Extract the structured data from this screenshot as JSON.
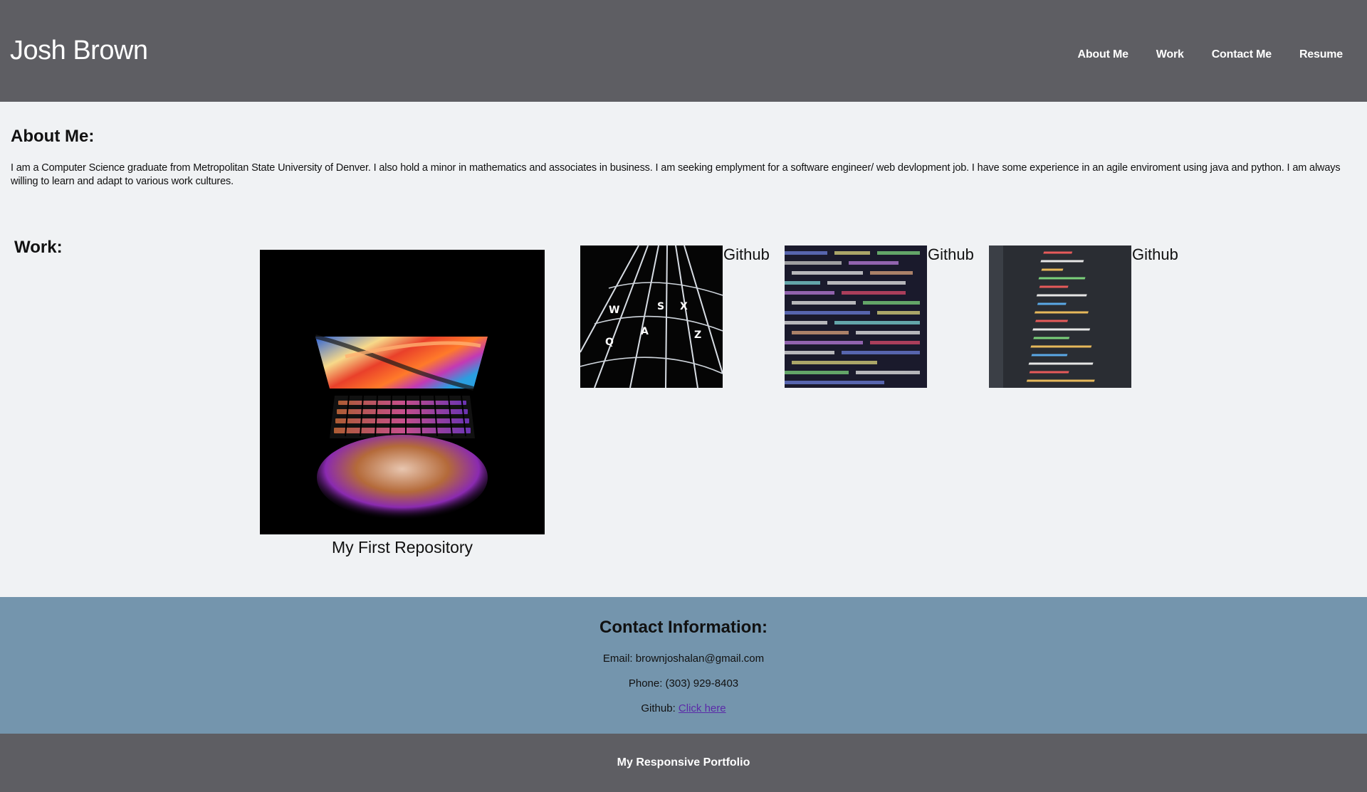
{
  "header": {
    "title": "Josh Brown",
    "nav": [
      "About Me",
      "Work",
      "Contact Me",
      "Resume"
    ]
  },
  "about": {
    "heading": "About Me:",
    "text": "I am a Computer Science graduate from Metropolitan State University of Denver. I also hold a minor in mathematics and associates in business. I am seeking emplyment for a software engineer/ web devlopment job. I have some experience in an agile enviroment using java and python. I am always willing to learn and adapt to various work cultures."
  },
  "work": {
    "heading": "Work:",
    "main_caption": "My First Repository",
    "thumb_label_1": "Github",
    "thumb_label_2": "Github",
    "thumb_label_3": "Github"
  },
  "contact": {
    "heading": "Contact Information:",
    "email": "Email: brownjoshalan@gmail.com",
    "phone": "Phone: (303) 929-8403",
    "github_prefix": "Github:",
    "github_link": "Click here"
  },
  "footer": {
    "text": "My Responsive Portfolio"
  },
  "colors": {
    "header_bg": "#5e5e63",
    "page_bg": "#f0f2f4",
    "contact_bg": "#7495ad",
    "link": "#5b2aa8"
  }
}
